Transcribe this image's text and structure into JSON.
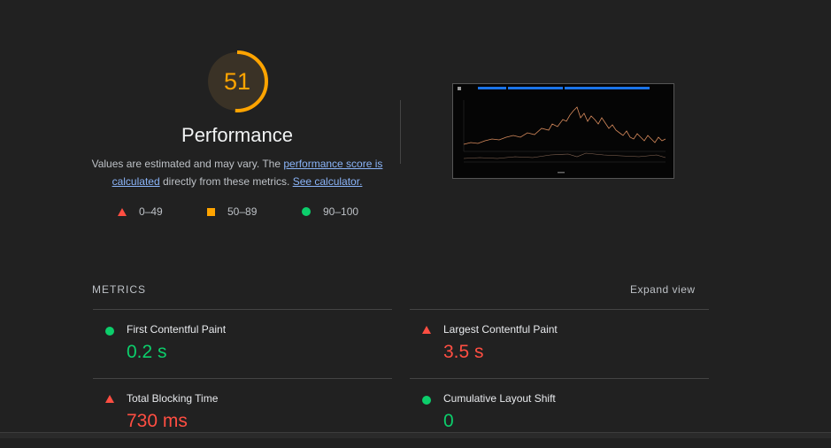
{
  "gauge": {
    "score": 51,
    "score_fraction": 0.51,
    "color": "#ffa400"
  },
  "category": {
    "title": "Performance",
    "desc_prefix": "Values are estimated and may vary. The ",
    "link1": "performance score is calculated",
    "desc_middle": " directly from these metrics. ",
    "link2": "See calculator."
  },
  "legend": [
    {
      "icon": "triangle-fail-icon",
      "label": "0–49",
      "color": "#ff4e42"
    },
    {
      "icon": "square-average-icon",
      "label": "50–89",
      "color": "#ffa400"
    },
    {
      "icon": "circle-pass-icon",
      "label": "90–100",
      "color": "#0cce6b"
    }
  ],
  "metrics_header": {
    "label": "METRICS",
    "expand": "Expand view"
  },
  "metrics": [
    {
      "title": "First Contentful Paint",
      "value": "0.2 s",
      "status": "pass"
    },
    {
      "title": "Largest Contentful Paint",
      "value": "3.5 s",
      "status": "fail"
    },
    {
      "title": "Total Blocking Time",
      "value": "730 ms",
      "status": "fail"
    },
    {
      "title": "Cumulative Layout Shift",
      "value": "0",
      "status": "pass"
    }
  ],
  "colors": {
    "pass": "#0cce6b",
    "average": "#ffa400",
    "fail": "#ff4e42",
    "link": "#8ab4f8"
  }
}
